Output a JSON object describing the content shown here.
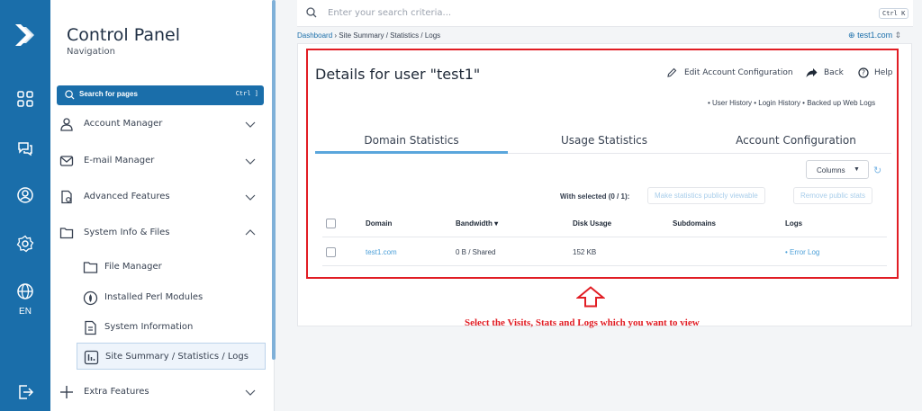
{
  "rail": {
    "language": "EN"
  },
  "nav": {
    "title": "Control Panel",
    "subtitle": "Navigation",
    "search_label": "Search for pages",
    "search_shortcut": "Ctrl ]",
    "items": [
      {
        "label": "Account Manager",
        "icon": "user-icon",
        "expanded": false
      },
      {
        "label": "E-mail Manager",
        "icon": "mail-icon",
        "expanded": false
      },
      {
        "label": "Advanced Features",
        "icon": "advanced-icon",
        "expanded": false
      },
      {
        "label": "System Info & Files",
        "icon": "folder-icon",
        "expanded": true
      },
      {
        "label": "Extra Features",
        "icon": "plus-icon",
        "expanded": false
      }
    ],
    "subitems": [
      {
        "label": "File Manager",
        "icon": "folder-icon"
      },
      {
        "label": "Installed Perl Modules",
        "icon": "perl-icon"
      },
      {
        "label": "System Information",
        "icon": "document-icon"
      },
      {
        "label": "Site Summary / Statistics / Logs",
        "icon": "chart-icon",
        "active": true
      }
    ]
  },
  "topbar": {
    "search_placeholder": "Enter your search criteria...",
    "shortcut": "Ctrl K"
  },
  "breadcrumb": {
    "home": "Dashboard",
    "rest": " › Site Summary / Statistics / Logs"
  },
  "domain_selector": "test1.com",
  "page": {
    "title": "Details for user \"test1\"",
    "actions": {
      "edit": "Edit Account Configuration",
      "back": "Back",
      "help": "Help"
    },
    "links": "• User History   • Login History   • Backed up Web Logs",
    "tabs": [
      "Domain Statistics",
      "Usage Statistics",
      "Account Configuration"
    ],
    "active_tab": "Domain Statistics",
    "columns_button": "Columns",
    "with_selected": "With selected (0 / 1):",
    "bulk_buttons": [
      "Make statistics publicly viewable",
      "Remove public stats"
    ],
    "table": {
      "headers": [
        "Domain",
        "Bandwidth ▾",
        "Disk Usage",
        "Subdomains",
        "Logs"
      ],
      "rows": [
        {
          "domain": "test1.com",
          "bandwidth": "0 B / Shared",
          "disk": "152 KB",
          "subdomains": "",
          "logs": "• Error Log"
        }
      ]
    }
  },
  "annotation": {
    "caption": "Select the Visits, Stats and Logs which you want to view",
    "color": "#e11d24"
  },
  "colors": {
    "brand": "#1a6eaa",
    "accent": "#5aa6dc"
  }
}
